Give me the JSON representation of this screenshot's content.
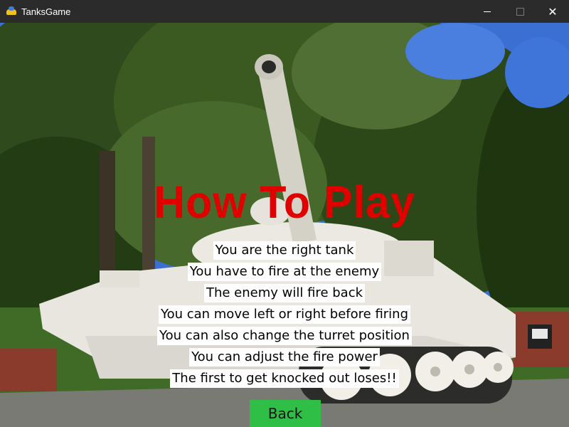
{
  "window": {
    "title": "TanksGame",
    "icon": "python-icon",
    "controls": {
      "minimize": "minimize-icon",
      "maximize": "maximize-icon",
      "close": "✕"
    }
  },
  "screen": {
    "heading": "How To Play",
    "heading_color": "#e00000",
    "instructions": [
      "You are the right tank",
      "You have to fire at the enemy",
      "The enemy will fire back",
      "You can move left or right before firing",
      "You can also change the turret position",
      "You can adjust the fire power",
      "The first to get knocked out loses!!"
    ],
    "back_label": "Back",
    "back_color": "#2fbf47"
  }
}
